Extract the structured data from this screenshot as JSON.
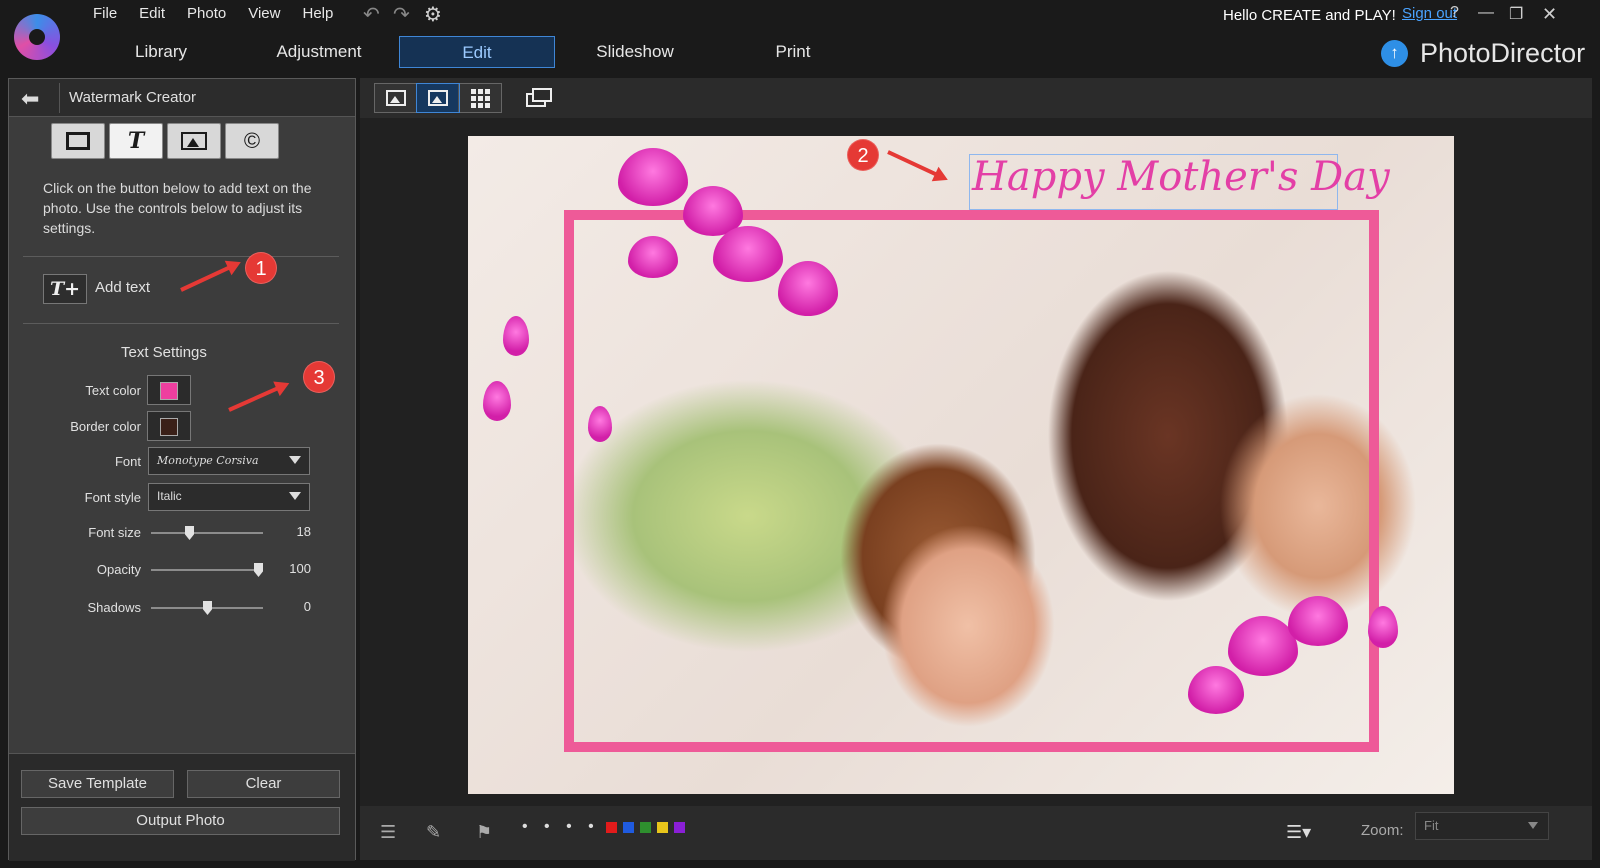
{
  "menu": [
    "File",
    "Edit",
    "Photo",
    "View",
    "Help"
  ],
  "header": {
    "greeting": "Hello CREATE and PLAY!",
    "signout": "Sign out",
    "help": "?",
    "brand": "PhotoDirector"
  },
  "tabs": [
    {
      "label": "Library",
      "active": false
    },
    {
      "label": "Adjustment",
      "active": false
    },
    {
      "label": "Edit",
      "active": true
    },
    {
      "label": "Slideshow",
      "active": false
    },
    {
      "label": "Print",
      "active": false
    }
  ],
  "panel": {
    "title": "Watermark Creator",
    "tool_tabs": [
      "rectangle-icon",
      "text-icon",
      "image-icon",
      "copyright-icon"
    ],
    "instructions": "Click on the button below to add text on the photo. Use the controls below to adjust its settings.",
    "add_text": "Add text",
    "settings_title": "Text Settings",
    "text_color_label": "Text color",
    "border_color_label": "Border color",
    "text_color": "#ee3f9f",
    "border_color": "#6b3a2a",
    "font_label": "Font",
    "font_value": "Monotype Corsiva",
    "font_style_label": "Font style",
    "font_style_value": "Italic",
    "font_size_label": "Font size",
    "font_size_value": "18",
    "opacity_label": "Opacity",
    "opacity_value": "100",
    "shadows_label": "Shadows",
    "shadows_value": "0",
    "save_template": "Save Template",
    "clear": "Clear",
    "output_photo": "Output Photo"
  },
  "canvas": {
    "watermark_text": "Happy Mother's Day",
    "annotations": [
      "1",
      "2",
      "3"
    ]
  },
  "bottom": {
    "zoom_label": "Zoom:",
    "zoom_value": "Fit",
    "flag_colors": [
      "#e21b1b",
      "#1f5be0",
      "#2e8f2e",
      "#e8c51b",
      "#8a1fd6"
    ],
    "dots": "• • • • •"
  }
}
